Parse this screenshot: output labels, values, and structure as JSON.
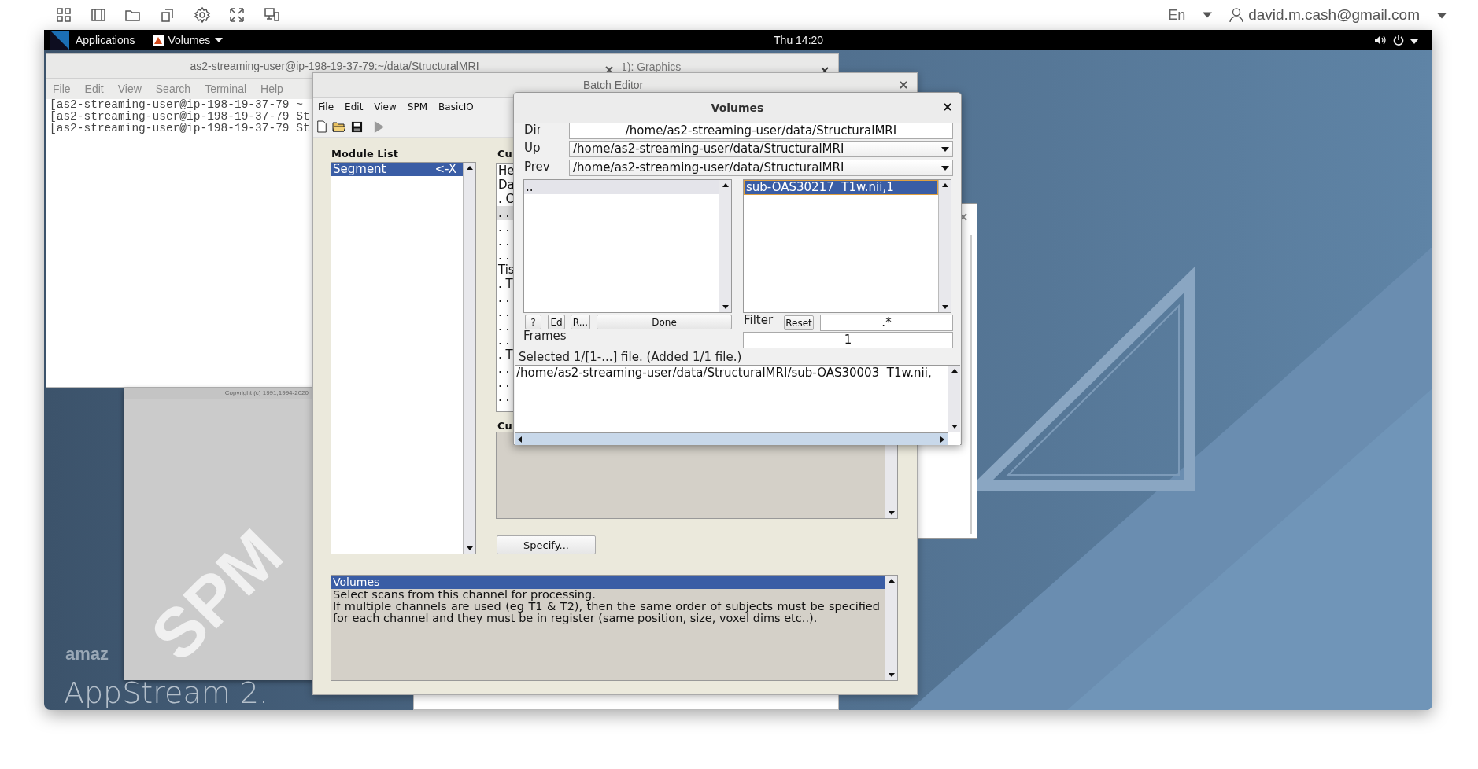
{
  "host_toolbar": {
    "keyboard": "En",
    "user": "david.m.cash@gmail.com"
  },
  "top_bar": {
    "applications": "Applications",
    "app_menu": "Volumes",
    "clock": "Thu 14:20"
  },
  "desktop": {
    "brand_small": "amaz",
    "brand_large": "AppStream 2."
  },
  "terminal": {
    "title": "as2-streaming-user@ip-198-19-37-79:~/data/StructuralMRI",
    "menu": [
      "File",
      "Edit",
      "View",
      "Search",
      "Terminal",
      "Help"
    ],
    "lines": [
      "[as2-streaming-user@ip-198-19-37-79 ~",
      "[as2-streaming-user@ip-198-19-37-79 St",
      "[as2-streaming-user@ip-198-19-37-79 St"
    ]
  },
  "graphics_window": {
    "title": "1): Graphics"
  },
  "splash": {
    "copyright": "Copyright (c) 1991,1994-2020",
    "logo": "SPM"
  },
  "batch_editor": {
    "title": "Batch Editor",
    "menu": [
      "File",
      "Edit",
      "View",
      "SPM",
      "BasicIO"
    ],
    "module_list_label": "Module List",
    "modules": [
      {
        "name": "Segment",
        "marker": "<-X",
        "selected": true
      }
    ],
    "current_item_label": "Cu",
    "tree_rows": [
      {
        "text": "He",
        "selected": false
      },
      {
        "text": "Da",
        "selected": false
      },
      {
        "text": ". C",
        "selected": false
      },
      {
        "text": ". .",
        "selected": true
      },
      {
        "text": ". .",
        "selected": false
      },
      {
        "text": ". .",
        "selected": false
      },
      {
        "text": ". .",
        "selected": false
      },
      {
        "text": "Tis",
        "selected": false
      },
      {
        "text": ". T",
        "selected": false
      },
      {
        "text": ". .",
        "selected": false
      },
      {
        "text": ". .",
        "selected": false
      },
      {
        "text": ". .",
        "selected": false
      },
      {
        "text": ". .",
        "selected": false
      },
      {
        "text": ". T",
        "selected": false
      },
      {
        "text": ". .",
        "selected": false
      },
      {
        "text": ". .",
        "selected": false
      },
      {
        "text": ". .",
        "selected": false
      }
    ],
    "current_value_label": "Cu",
    "specify_button": "Specify...",
    "help": {
      "heading": "Volumes",
      "paragraphs": [
        "Select scans from this channel for processing.",
        "If multiple channels are used (eg T1 & T2), then the same order of subjects must be specified for each channel and they must be in register (same position, size, voxel dims etc..)."
      ]
    }
  },
  "volumes_dialog": {
    "title": "Volumes",
    "dir_label": "Dir",
    "dir": "/home/as2-streaming-user/data/StructuralMRI",
    "up_label": "Up",
    "up": "/home/as2-streaming-user/data/StructuralMRI",
    "prev_label": "Prev",
    "prev": "/home/as2-streaming-user/data/StructuralMRI",
    "directories": [
      {
        "name": "..",
        "selected": true
      }
    ],
    "files": [
      {
        "name": "sub-OAS30217  T1w.nii,1",
        "selected": true
      }
    ],
    "buttons": [
      "?",
      "Ed",
      "R...",
      "Done"
    ],
    "filter_label": "Filter",
    "reset_button": "Reset",
    "filter": ".*",
    "frames_label": "Frames",
    "frames": "1",
    "status": "Selected 1/[1-...] file. (Added 1/1 file.)",
    "selected_files": [
      "/home/as2-streaming-user/data/StructuralMRI/sub-OAS30003  T1w.nii,"
    ]
  }
}
